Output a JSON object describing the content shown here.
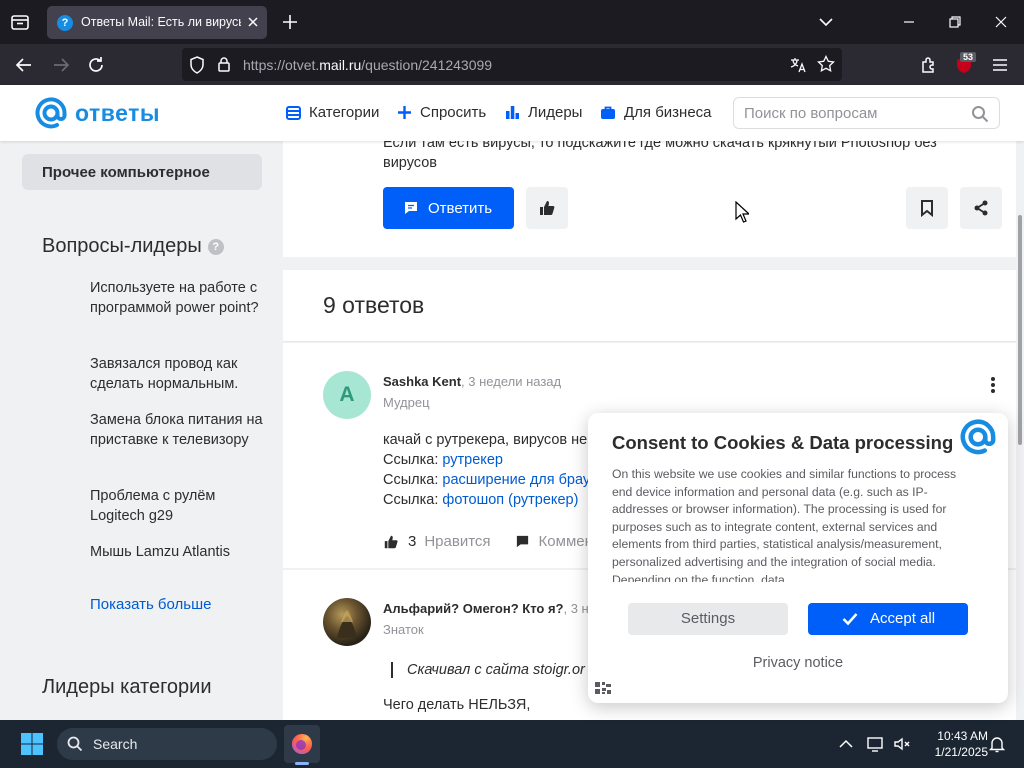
{
  "browser": {
    "tab_title": "Ответы Mail: Есть ли вирусы в",
    "url_prefix": "https://otvet.",
    "url_host": "mail.ru",
    "url_path": "/question/241243099",
    "extension_badge": "53"
  },
  "header": {
    "logo_text": "ответы",
    "nav": [
      {
        "label": "Категории",
        "icon": "list-icon"
      },
      {
        "label": "Спросить",
        "icon": "plus-icon"
      },
      {
        "label": "Лидеры",
        "icon": "bar-chart-icon"
      },
      {
        "label": "Для бизнеса",
        "icon": "briefcase-icon"
      }
    ],
    "search_placeholder": "Поиск по вопросам"
  },
  "sidebar": {
    "active_category": "Прочее компьютерное",
    "leaders_title": "Вопросы-лидеры",
    "leader_questions": [
      "Используете на работе с программой power point?",
      "Завязался провод как сделать нормальным.",
      "Замена блока питания на приставке к телевизору",
      "Проблема с рулём Logitech g29",
      "Мышь Lamzu Atlantis"
    ],
    "show_more": "Показать больше",
    "category_leaders_title": "Лидеры категории"
  },
  "question": {
    "text_partial": "Если там есть вирусы, то подскажите где можно скачать крякнутый Photoshop без вирусов",
    "reply_button": "Ответить"
  },
  "answers": {
    "count_label": "9 ответов",
    "items": [
      {
        "avatar_letter": "A",
        "author": "Sashka Kent",
        "time": ", 3 недели назад",
        "rank": "Мудрец",
        "text": "качай с рутрекера, вирусов не",
        "links": [
          {
            "prefix": "Ссылка: ",
            "label": "рутрекер"
          },
          {
            "prefix": "Ссылка: ",
            "label": "расширение для брау"
          },
          {
            "prefix": "Ссылка: ",
            "label": "фотошоп (рутрекер)"
          }
        ],
        "likes": "3",
        "like_label": "Нравится",
        "comment_label": "Коммен"
      },
      {
        "author": "Альфарий? Омегон? Кто я?",
        "time": ", 3 н",
        "rank": "Знаток",
        "quote": "Скачивал с сайта stoigr.or",
        "text": "Чего делать НЕЛЬЗЯ,"
      }
    ]
  },
  "cookie_dialog": {
    "title": "Consent to Cookies & Data processing",
    "body": "On this website we use cookies and similar functions to process end device information and personal data (e.g. such as IP-addresses or browser information). The processing is used for purposes such as to integrate content, external services and elements from third parties, statistical analysis/measurement, personalized advertising and the integration of social media. Depending on the function, data",
    "settings_button": "Settings",
    "accept_button": "Accept all",
    "privacy_link": "Privacy notice"
  },
  "taskbar": {
    "search_label": "Search",
    "time": "10:43 AM",
    "date": "1/21/2025"
  },
  "colors": {
    "brand_blue": "#005ff9",
    "logo_blue": "#168de2",
    "link_blue": "#005bd1",
    "sidebar_bg": "#f0f1f3"
  }
}
